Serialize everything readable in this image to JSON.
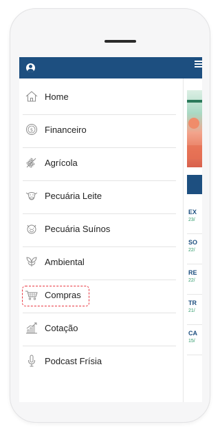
{
  "menu": {
    "items": [
      {
        "label": "Home",
        "icon": "home-icon"
      },
      {
        "label": "Financeiro",
        "icon": "coin-icon"
      },
      {
        "label": "Agrícola",
        "icon": "wheat-icon"
      },
      {
        "label": "Pecuária Leite",
        "icon": "cow-icon"
      },
      {
        "label": "Pecuária Suínos",
        "icon": "pig-icon"
      },
      {
        "label": "Ambiental",
        "icon": "leaves-icon"
      },
      {
        "label": "Compras",
        "icon": "cart-icon"
      },
      {
        "label": "Cotação",
        "icon": "bar-chart-icon"
      },
      {
        "label": "Podcast Frísia",
        "icon": "microphone-icon"
      }
    ],
    "highlighted_item": "Compras"
  },
  "news": [
    {
      "title": "EX",
      "date": "23/"
    },
    {
      "title": "SO",
      "date": "22/"
    },
    {
      "title": "RE",
      "date": "22/"
    },
    {
      "title": "TR",
      "date": "21/"
    },
    {
      "title": "CA",
      "date": "15/"
    }
  ],
  "colors": {
    "header": "#1d4f80",
    "highlight_border": "#e8323c",
    "news_title": "#1d4f80",
    "news_date": "#2f9a6b"
  }
}
